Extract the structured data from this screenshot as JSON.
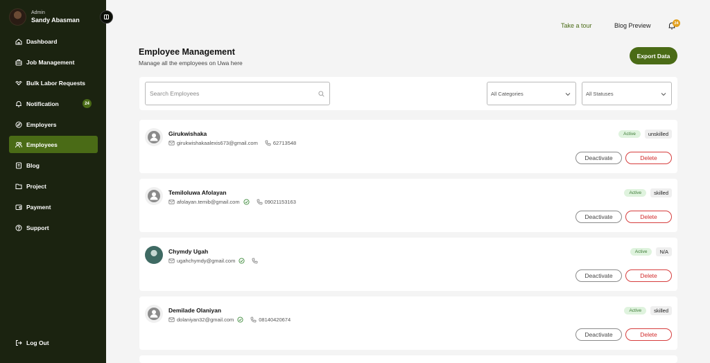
{
  "sidebar": {
    "profile": {
      "role": "Admin",
      "name": "Sandy Abasman"
    },
    "items": [
      {
        "label": "Dashboard",
        "icon": "home-icon"
      },
      {
        "label": "Job Management",
        "icon": "briefcase-icon"
      },
      {
        "label": "Bulk Labor Requests",
        "icon": "handshake-icon"
      },
      {
        "label": "Notification",
        "icon": "bell-icon",
        "badge": "24"
      },
      {
        "label": "Employers",
        "icon": "compass-icon"
      },
      {
        "label": "Employees",
        "icon": "users-icon",
        "active": true
      },
      {
        "label": "Blog",
        "icon": "book-icon"
      },
      {
        "label": "Project",
        "icon": "folder-icon"
      },
      {
        "label": "Payment",
        "icon": "wallet-icon"
      },
      {
        "label": "Support",
        "icon": "help-icon"
      }
    ],
    "logout": "Log Out"
  },
  "topbar": {
    "take_tour": "Take a tour",
    "blog_preview": "Blog Preview",
    "notification_count": "24"
  },
  "header": {
    "title": "Employee Management",
    "subtitle": "Manage all the employees on Uwa here",
    "export_label": "Export Data"
  },
  "filters": {
    "search_placeholder": "Search Employees",
    "category": "All Categories",
    "status": "All Statuses"
  },
  "employees": [
    {
      "name": "Girukwishaka",
      "email": "girukwishakaalexis673@gmail.com",
      "verified": false,
      "phone": "62713548",
      "status": "Active",
      "skill": "unskilled",
      "has_photo": false
    },
    {
      "name": "Temiloluwa Afolayan",
      "email": "afolayan.temib@gmail.com",
      "verified": true,
      "phone": "09021153163",
      "status": "Active",
      "skill": "skilled",
      "has_photo": false
    },
    {
      "name": "Chymdy Ugah",
      "email": "ugahchymdy@gmail.com",
      "verified": true,
      "phone": "",
      "status": "Active",
      "skill": "N/A",
      "has_photo": true
    },
    {
      "name": "Demilade Olaniyan",
      "email": "dolaniyan32@gmail.com",
      "verified": true,
      "phone": "08140420674",
      "status": "Active",
      "skill": "skilled",
      "has_photo": false
    }
  ],
  "actions": {
    "deactivate": "Deactivate",
    "delete": "Delete"
  },
  "colors": {
    "sidebar_bg": "#1b2310",
    "accent": "#4a6b16",
    "danger": "#d22c2c",
    "badge": "#e2a01f"
  }
}
